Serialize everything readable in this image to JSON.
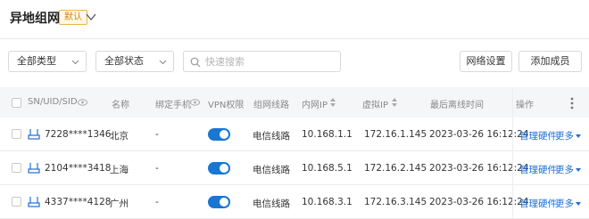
{
  "header": {
    "title": "异地组网",
    "badge": "默认"
  },
  "toolbar": {
    "type_select": "全部类型",
    "status_select": "全部状态",
    "search_placeholder": "快速搜索",
    "network_settings": "网络设置",
    "add_member": "添加成员"
  },
  "table": {
    "columns": {
      "sn": "SN/UID/SID",
      "name": "名称",
      "phone": "绑定手机",
      "vpn": "VPN权限",
      "line": "组网线路",
      "lan_ip": "内网IP",
      "virtual_ip": "虚拟IP",
      "last_online": "最后离线时间",
      "actions": "操作"
    },
    "rows": [
      {
        "sn": "7228****1346",
        "name": "北京",
        "phone": "-",
        "vpn": true,
        "line": "电信线路",
        "lan_ip": "10.168.1.1",
        "virtual_ip": "172.16.1.145",
        "last_online": "2023-03-26 16:12:24",
        "manage": "管理硬件",
        "more": "更多"
      },
      {
        "sn": "2104****3418",
        "name": "上海",
        "phone": "-",
        "vpn": true,
        "line": "电信线路",
        "lan_ip": "10.168.5.1",
        "virtual_ip": "172.16.2.145",
        "last_online": "2023-03-26 16:12:24",
        "manage": "管理硬件",
        "more": "更多"
      },
      {
        "sn": "4337****4128",
        "name": "广州",
        "phone": "-",
        "vpn": true,
        "line": "电信线路",
        "lan_ip": "10.168.3.1",
        "virtual_ip": "172.16.3.145",
        "last_online": "2023-03-26 16:12:24",
        "manage": "管理硬件",
        "more": "更多"
      }
    ]
  },
  "colors": {
    "accent": "#1976d2",
    "link": "#1f6fd6",
    "badge_border": "#e9b64a"
  },
  "icons": [
    "chevron-down-icon",
    "search-icon",
    "eye-icon",
    "sort-icon",
    "router-icon",
    "more-vertical-icon"
  ]
}
